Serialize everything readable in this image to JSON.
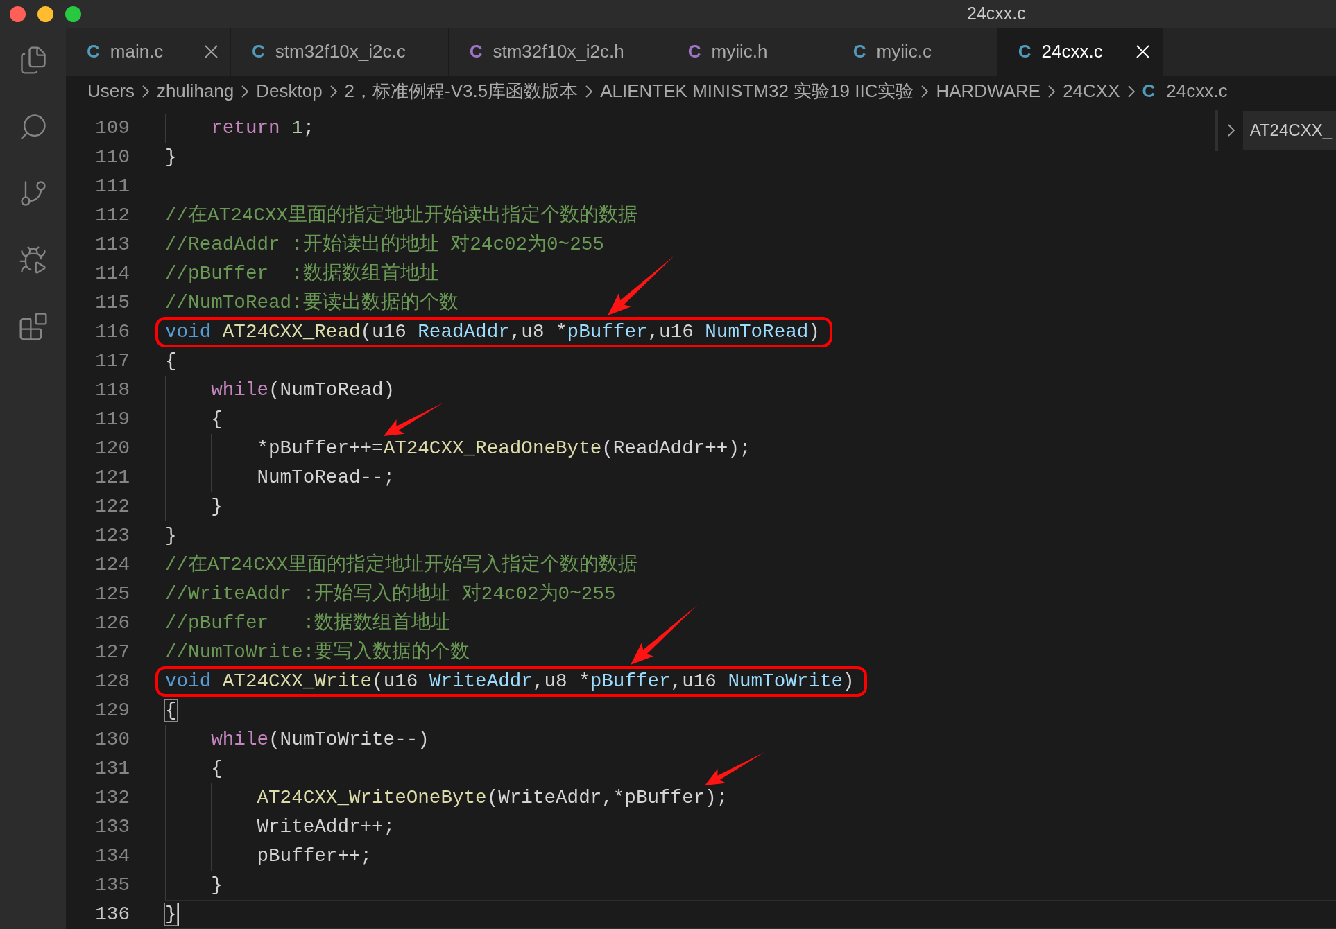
{
  "window": {
    "title": "24cxx.c"
  },
  "tabs": [
    {
      "icon": "C",
      "kind": "c",
      "label": "main.c",
      "selected": false,
      "close_visible": true
    },
    {
      "icon": "C",
      "kind": "c",
      "label": "stm32f10x_i2c.c",
      "selected": false,
      "close_visible": false
    },
    {
      "icon": "C",
      "kind": "h",
      "label": "stm32f10x_i2c.h",
      "selected": false,
      "close_visible": false
    },
    {
      "icon": "C",
      "kind": "h",
      "label": "myiic.h",
      "selected": false,
      "close_visible": false
    },
    {
      "icon": "C",
      "kind": "c",
      "label": "myiic.c",
      "selected": false,
      "close_visible": false
    },
    {
      "icon": "C",
      "kind": "c",
      "label": "24cxx.c",
      "selected": true,
      "close_visible": true
    }
  ],
  "breadcrumb": [
    {
      "label": "Users"
    },
    {
      "label": "zhulihang"
    },
    {
      "label": "Desktop"
    },
    {
      "label": "2，标准例程-V3.5库函数版本"
    },
    {
      "label": "ALIENTEK MINISTM32 实验19 IIC实验"
    },
    {
      "label": "HARDWARE"
    },
    {
      "label": "24CXX"
    },
    {
      "label": "24cxx.c",
      "icon": "C",
      "kind": "c"
    }
  ],
  "symbol_panel": {
    "label": "AT24CXX_"
  },
  "editor": {
    "lines": [
      {
        "number": "109",
        "current": false,
        "framed": false,
        "bracket_match": false,
        "segments": [
          {
            "text": "    return ",
            "kind": "control"
          },
          {
            "text": "1",
            "kind": "number"
          },
          {
            "text": ";",
            "kind": "plain"
          }
        ]
      },
      {
        "number": "110",
        "current": false,
        "framed": false,
        "bracket_match": false,
        "segments": [
          {
            "text": "}",
            "kind": "plain"
          }
        ]
      },
      {
        "number": "111",
        "current": false,
        "framed": false,
        "bracket_match": false
      },
      {
        "number": "112",
        "current": false,
        "framed": false,
        "bracket_match": false,
        "segments": [
          {
            "text": "//在AT24CXX里面的指定地址开始读出指定个数的数据",
            "kind": "comment"
          }
        ]
      },
      {
        "number": "113",
        "current": false,
        "framed": false,
        "bracket_match": false,
        "segments": [
          {
            "text": "//ReadAddr :开始读出的地址 对24c02为0~255",
            "kind": "comment"
          }
        ]
      },
      {
        "number": "114",
        "current": false,
        "framed": false,
        "bracket_match": false,
        "segments": [
          {
            "text": "//pBuffer  :数据数组首地址",
            "kind": "comment"
          }
        ]
      },
      {
        "number": "115",
        "current": false,
        "framed": false,
        "bracket_match": false,
        "segments": [
          {
            "text": "//NumToRead:要读出数据的个数",
            "kind": "comment"
          }
        ]
      },
      {
        "number": "116",
        "current": false,
        "framed": true,
        "bracket_match": false,
        "segments": [
          {
            "text": "void ",
            "kind": "keyword"
          },
          {
            "text": "AT24CXX_Read",
            "kind": "function"
          },
          {
            "text": "(u16 ",
            "kind": "plain"
          },
          {
            "text": "ReadAddr",
            "kind": "param"
          },
          {
            "text": ",u8 *",
            "kind": "plain"
          },
          {
            "text": "pBuffer",
            "kind": "param",
            "arrow": {
              "kind": "middle"
            }
          },
          {
            "text": ",u16 ",
            "kind": "plain"
          },
          {
            "text": "NumToRead",
            "kind": "param"
          },
          {
            "text": ")",
            "kind": "plain"
          }
        ]
      },
      {
        "number": "117",
        "current": false,
        "framed": false,
        "bracket_match": false,
        "segments": [
          {
            "text": "{",
            "kind": "plain"
          }
        ]
      },
      {
        "number": "118",
        "current": false,
        "framed": false,
        "bracket_match": false,
        "segments": [
          {
            "text": "    while",
            "kind": "control"
          },
          {
            "text": "(NumToRead)",
            "kind": "plain"
          }
        ]
      },
      {
        "number": "119",
        "current": false,
        "framed": false,
        "bracket_match": false,
        "segments": [
          {
            "text": "    {",
            "kind": "plain"
          }
        ]
      },
      {
        "number": "120",
        "current": false,
        "framed": false,
        "bracket_match": false,
        "segments": [
          {
            "text": "        *pBuffer++=",
            "kind": "plain",
            "arrow": {
              "kind": "end"
            }
          },
          {
            "text": "AT24CXX_ReadOneByte",
            "kind": "function"
          },
          {
            "text": "(ReadAddr++);",
            "kind": "plain"
          }
        ]
      },
      {
        "number": "121",
        "current": false,
        "framed": false,
        "bracket_match": false,
        "segments": [
          {
            "text": "        NumToRead--;",
            "kind": "plain"
          }
        ]
      },
      {
        "number": "122",
        "current": false,
        "framed": false,
        "bracket_match": false,
        "segments": [
          {
            "text": "    }",
            "kind": "plain"
          }
        ]
      },
      {
        "number": "123",
        "current": false,
        "framed": false,
        "bracket_match": false,
        "segments": [
          {
            "text": "}",
            "kind": "plain"
          }
        ]
      },
      {
        "number": "124",
        "current": false,
        "framed": false,
        "bracket_match": false,
        "segments": [
          {
            "text": "//在AT24CXX里面的指定地址开始写入指定个数的数据",
            "kind": "comment"
          }
        ]
      },
      {
        "number": "125",
        "current": false,
        "framed": false,
        "bracket_match": false,
        "segments": [
          {
            "text": "//WriteAddr :开始写入的地址 对24c02为0~255",
            "kind": "comment"
          }
        ]
      },
      {
        "number": "126",
        "current": false,
        "framed": false,
        "bracket_match": false,
        "segments": [
          {
            "text": "//pBuffer   :数据数组首地址",
            "kind": "comment"
          }
        ]
      },
      {
        "number": "127",
        "current": false,
        "framed": false,
        "bracket_match": false,
        "segments": [
          {
            "text": "//NumToWrite:要写入数据的个数",
            "kind": "comment"
          }
        ]
      },
      {
        "number": "128",
        "current": false,
        "framed": true,
        "bracket_match": false,
        "segments": [
          {
            "text": "void ",
            "kind": "keyword"
          },
          {
            "text": "AT24CXX_Write",
            "kind": "function"
          },
          {
            "text": "(u16 ",
            "kind": "plain"
          },
          {
            "text": "WriteAddr",
            "kind": "param"
          },
          {
            "text": ",u8 *",
            "kind": "plain"
          },
          {
            "text": "pBuffer",
            "kind": "param",
            "arrow": {
              "kind": "middle"
            }
          },
          {
            "text": ",u16 ",
            "kind": "plain"
          },
          {
            "text": "NumToWrite",
            "kind": "param"
          },
          {
            "text": ")",
            "kind": "plain"
          }
        ]
      },
      {
        "number": "129",
        "current": false,
        "framed": false,
        "bracket_match": true,
        "segments": [
          {
            "text": "{",
            "kind": "plain"
          }
        ]
      },
      {
        "number": "130",
        "current": false,
        "framed": false,
        "bracket_match": false,
        "segments": [
          {
            "text": "    while",
            "kind": "control"
          },
          {
            "text": "(NumToWrite--)",
            "kind": "plain"
          }
        ]
      },
      {
        "number": "131",
        "current": false,
        "framed": false,
        "bracket_match": false,
        "segments": [
          {
            "text": "    {",
            "kind": "plain"
          }
        ]
      },
      {
        "number": "132",
        "current": false,
        "framed": false,
        "bracket_match": false,
        "segments": [
          {
            "text": "        AT24CXX_WriteOneByte",
            "kind": "function"
          },
          {
            "text": "(WriteAddr,",
            "kind": "plain"
          },
          {
            "text": "*pBuffer",
            "kind": "plain",
            "arrow": {
              "kind": "end"
            }
          },
          {
            "text": ");",
            "kind": "plain"
          }
        ]
      },
      {
        "number": "133",
        "current": false,
        "framed": false,
        "bracket_match": false,
        "segments": [
          {
            "text": "        WriteAddr++;",
            "kind": "plain"
          }
        ]
      },
      {
        "number": "134",
        "current": false,
        "framed": false,
        "bracket_match": false,
        "segments": [
          {
            "text": "        pBuffer++;",
            "kind": "plain"
          }
        ]
      },
      {
        "number": "135",
        "current": false,
        "framed": false,
        "bracket_match": false,
        "segments": [
          {
            "text": "    }",
            "kind": "plain"
          }
        ]
      },
      {
        "number": "136",
        "current": true,
        "framed": false,
        "bracket_match": true,
        "segments": [
          {
            "text": "}",
            "kind": "plain"
          }
        ]
      }
    ]
  }
}
